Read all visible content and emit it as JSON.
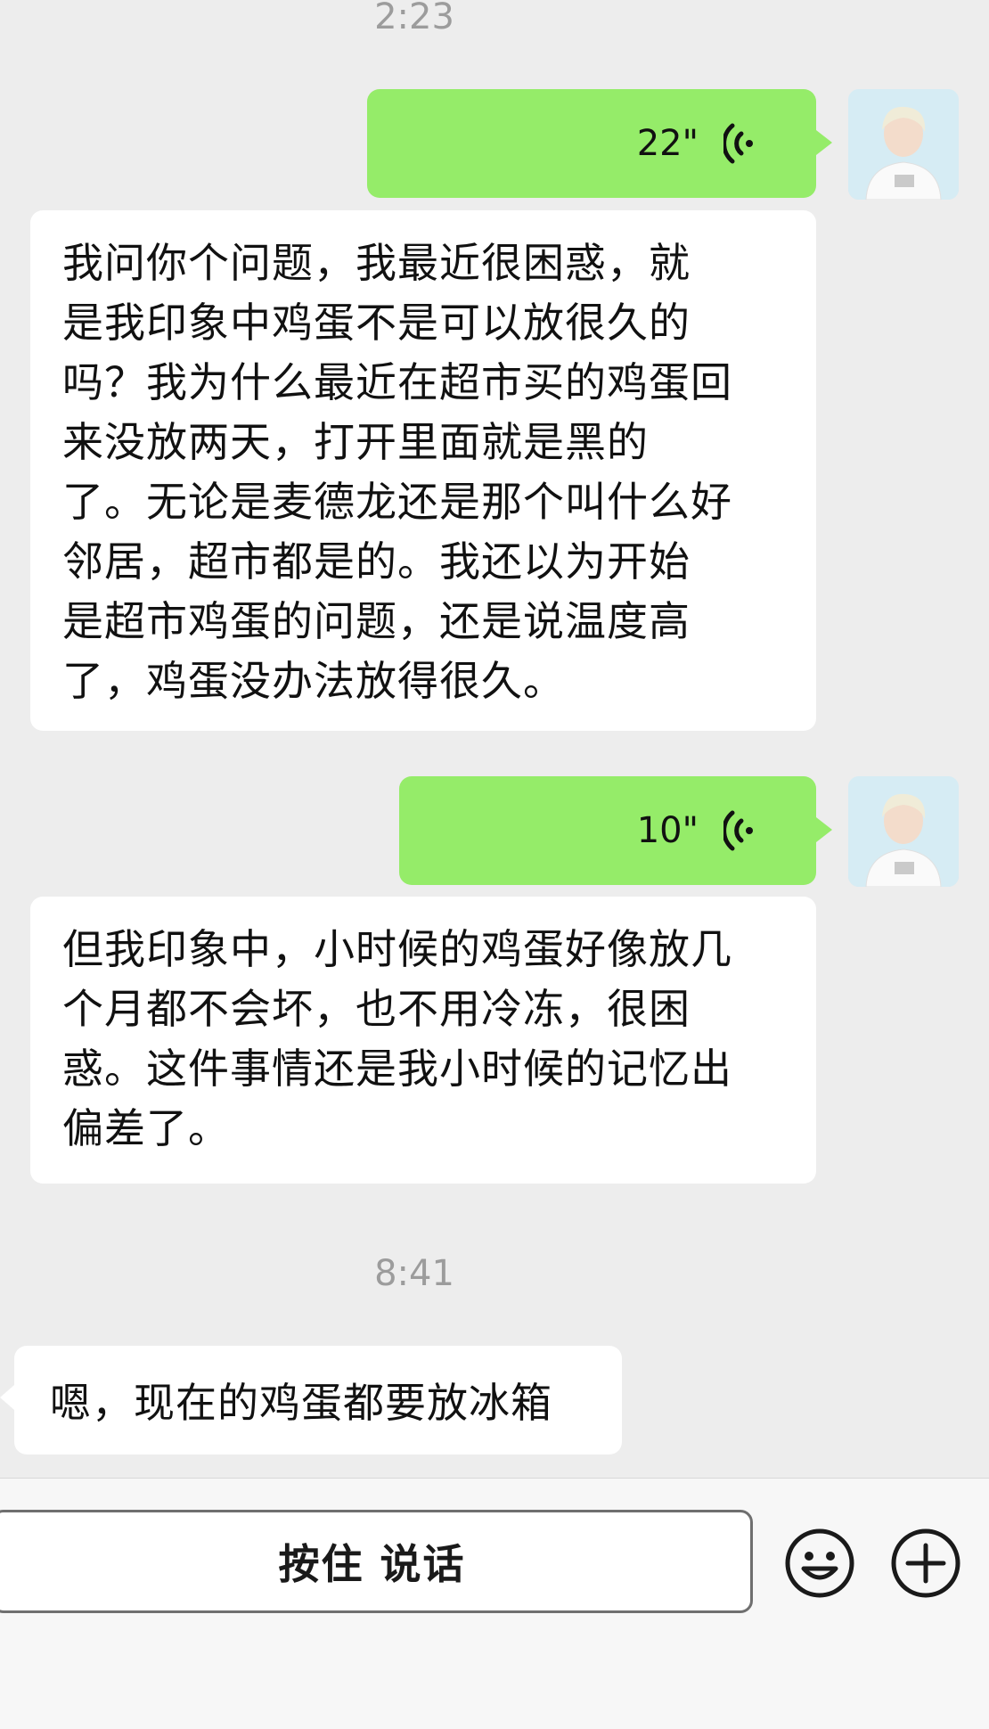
{
  "chat": {
    "time_top": "2:23",
    "voice1": {
      "duration": "22\""
    },
    "transcript1": {
      "lines": [
        "我问你个问题，我最近很困惑，就",
        "是我印象中鸡蛋不是可以放很久的",
        "吗？我为什么最近在超市买的鸡蛋回",
        "来没放两天，打开里面就是黑的",
        "了。无论是麦德龙还是那个叫什么好",
        "邻居，超市都是的。我还以为开始",
        "是超市鸡蛋的问题，还是说温度高",
        "了，鸡蛋没办法放得很久。"
      ]
    },
    "voice2": {
      "duration": "10\""
    },
    "transcript2": {
      "lines": [
        "但我印象中，小时候的鸡蛋好像放几",
        "个月都不会坏，也不用冷冻，很困",
        "惑。这件事情还是我小时候的记忆出",
        "偏差了。"
      ]
    },
    "time_mid": "8:41",
    "incoming_message": "嗯，现在的鸡蛋都要放冰箱"
  },
  "input_bar": {
    "hold_to_talk": "按住 说话",
    "emoji_icon": "smiley-face-icon",
    "plus_icon": "plus-circle-icon"
  },
  "colors": {
    "background": "#ededed",
    "outgoing_bubble": "#95ec69",
    "incoming_bubble": "#ffffff",
    "timestamp": "#9c9c9c"
  }
}
